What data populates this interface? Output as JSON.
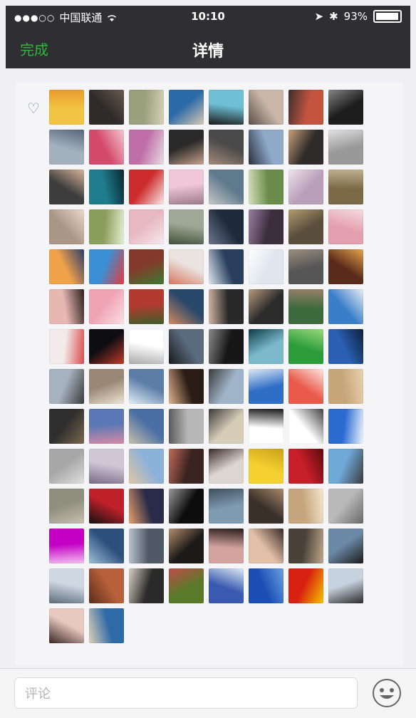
{
  "status_bar": {
    "carrier": "中国联通",
    "time": "10:10",
    "battery": "93%"
  },
  "nav": {
    "done_label": "完成",
    "title": "详情"
  },
  "likes": {
    "heart_icon": "heart-outline-icon",
    "avatar_count": 106
  },
  "comment": {
    "placeholder": "评论",
    "emoji_icon": "smiley-face-icon"
  }
}
